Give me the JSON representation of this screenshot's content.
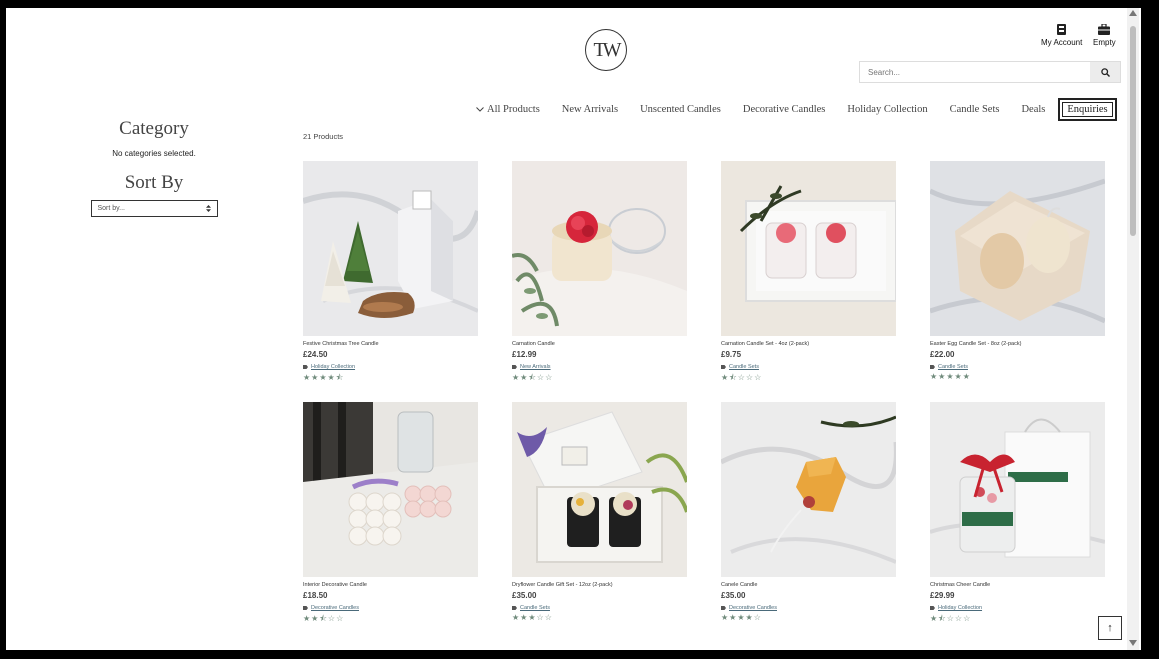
{
  "brand": {
    "logo_text": "TW"
  },
  "header": {
    "account_label": "My Account",
    "cart_label": "Empty",
    "search_placeholder": "Search..."
  },
  "nav": {
    "items": [
      "All Products",
      "New Arrivals",
      "Unscented Candles",
      "Decorative Candles",
      "Holiday Collection",
      "Candle Sets",
      "Deals"
    ],
    "enquiries": "Enquiries"
  },
  "sidebar": {
    "category_title": "Category",
    "category_empty": "No categories selected.",
    "sort_title": "Sort By",
    "sort_selected": "Sort by..."
  },
  "listing": {
    "count_label": "21 Products",
    "products": [
      {
        "name": "Festive Christmas Tree Candle",
        "price": "£24.50",
        "category": "Holiday Collection",
        "rating": 4.5,
        "stars": "★★★★⯪"
      },
      {
        "name": "Carnation Candle",
        "price": "£12.99",
        "category": "New Arrivals",
        "rating": 2.5,
        "stars": "★★⯪☆☆"
      },
      {
        "name": "Carnation Candle Set - 4oz (2-pack)",
        "price": "£9.75",
        "category": "Candle Sets",
        "rating": 1.5,
        "stars": "★⯪☆☆☆"
      },
      {
        "name": "Easter Egg Candle Set - 8oz (2-pack)",
        "price": "£22.00",
        "category": "Candle Sets",
        "rating": 5,
        "stars": "★★★★★"
      },
      {
        "name": "Interior Decorative Candle",
        "price": "£18.50",
        "category": "Decorative Candles",
        "rating": 2.5,
        "stars": "★★⯪☆☆"
      },
      {
        "name": "Dryflower Candle Gift Set - 12oz (2-pack)",
        "price": "£35.00",
        "category": "Candle Sets",
        "rating": 3,
        "stars": "★★★☆☆"
      },
      {
        "name": "Canele Candle",
        "price": "£35.00",
        "category": "Decorative Candles",
        "rating": 4,
        "stars": "★★★★☆"
      },
      {
        "name": "Christmas Cheer Candle",
        "price": "£29.99",
        "category": "Holiday Collection",
        "rating": 1.5,
        "stars": "★⯪☆☆☆"
      }
    ]
  },
  "back_to_top": "↑",
  "icons": {
    "account": "account-icon",
    "cart": "briefcase-icon",
    "search": "search-icon",
    "chevron": "chevron-down-icon",
    "tag": "tag-icon",
    "select_arrows": "select-arrows-icon"
  },
  "colors": {
    "star": "#6f8a7b",
    "link": "#4a6a7a",
    "frame": "#000000"
  }
}
